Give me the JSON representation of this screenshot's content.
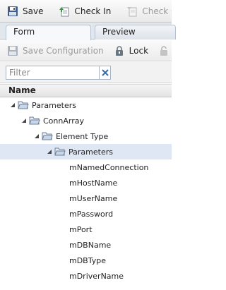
{
  "toolbar": {
    "save_label": "Save",
    "checkin_label": "Check In",
    "checkout_label": "Check Ou"
  },
  "tabs": [
    {
      "label": "Form"
    },
    {
      "label": "Preview"
    }
  ],
  "subtoolbar": {
    "save_config_label": "Save Configuration",
    "lock_label": "Lock"
  },
  "filter": {
    "placeholder": "Filter",
    "value": ""
  },
  "tree": {
    "column_header": "Name",
    "nodes": [
      {
        "label": "Parameters"
      },
      {
        "label": "ConnArray"
      },
      {
        "label": "Element Type"
      },
      {
        "label": "Parameters"
      },
      {
        "label": "mNamedConnection"
      },
      {
        "label": "mHostName"
      },
      {
        "label": "mUserName"
      },
      {
        "label": "mPassword"
      },
      {
        "label": "mPort"
      },
      {
        "label": "mDBName"
      },
      {
        "label": "mDBType"
      },
      {
        "label": "mDriverName"
      }
    ]
  }
}
